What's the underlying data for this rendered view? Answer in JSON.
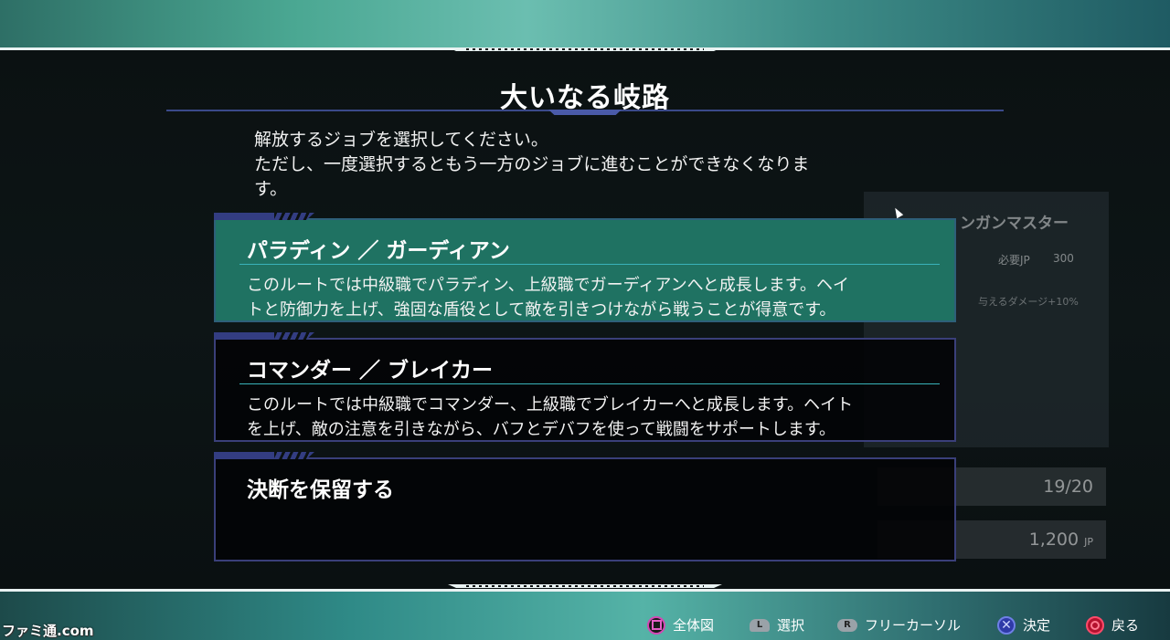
{
  "dialog": {
    "title": "大いなる岐路",
    "description_lines": [
      "解放するジョブを選択してください。",
      "ただし、一度選択するともう一方のジョブに進むことができなくなりま",
      "す。"
    ]
  },
  "options": [
    {
      "title": "パラディン ／ ガーディアン",
      "body_lines": [
        "このルートでは中級職でパラディン、上級職でガーディアンへと成長します。ヘイ",
        "トと防御力を上げ、強固な盾役として敵を引きつけながら戦うことが得意です。"
      ],
      "selected": true
    },
    {
      "title": "コマンダー ／ ブレイカー",
      "body_lines": [
        "このルートでは中級職でコマンダー、上級職でブレイカーへと成長します。ヘイト",
        "を上げ、敵の注意を引きながら、バフとデバフを使って戦闘をサポートします。"
      ],
      "selected": false
    },
    {
      "title": "決断を保留する",
      "body_lines": [],
      "selected": false
    }
  ],
  "background_panel": {
    "title": "ンガンマスター",
    "jp_label": "必要JP",
    "jp_value": "300",
    "effect": "与えるダメージ+10%",
    "stat_1": "19/20",
    "stat_2": "1,200",
    "stat_2_unit": "JP"
  },
  "footer": {
    "logo": "ファミ通.com",
    "hints": [
      {
        "icon": "square-button-icon",
        "glyph": "",
        "label": "全体図"
      },
      {
        "icon": "l-stick-icon",
        "glyph": "L",
        "label": "選択"
      },
      {
        "icon": "r-stick-icon",
        "glyph": "R",
        "label": "フリーカーソル"
      },
      {
        "icon": "cross-button-icon",
        "glyph": "✕",
        "label": "決定"
      },
      {
        "icon": "circle-button-icon",
        "glyph": "",
        "label": "戻る"
      }
    ]
  },
  "colors": {
    "selected_option_bg": "#1f7262",
    "option_border": "#3a3f7a",
    "separator": "#39b3ba"
  }
}
